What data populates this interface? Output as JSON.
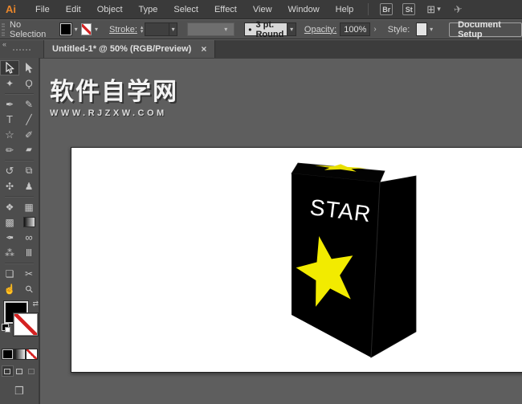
{
  "menu_bar": {
    "logo": "Ai",
    "items": [
      "File",
      "Edit",
      "Object",
      "Type",
      "Select",
      "Effect",
      "View",
      "Window",
      "Help"
    ],
    "bridge_badge": "Br",
    "stock_badge": "St",
    "workspace_icon": "⊞",
    "workspace_chevron": "▾",
    "gpu_icon": "✈"
  },
  "control_bar": {
    "selection_status": "No Selection",
    "fill_chevron": "▾",
    "stroke_chevron": "▾",
    "stroke_label": "Stroke:",
    "spinner_up": "▴",
    "spinner_down": "▾",
    "stroke_weight_value": "",
    "stroke_weight_chevron": "▾",
    "brush_chevron": "▾",
    "profile_dot": "•",
    "profile_value": "3 pt. Round",
    "profile_chevron": "▾",
    "opacity_label": "Opacity:",
    "opacity_value": "100%",
    "opacity_chevron": "›",
    "style_label": "Style:",
    "style_chevron": "▾",
    "document_setup_label": "Document Setup"
  },
  "tab_bar": {
    "collapse_icon": "«",
    "active_tab": "Untitled-1* @ 50% (RGB/Preview)",
    "close_icon": "×"
  },
  "toolbar": {
    "tools": [
      {
        "name": "selection-tool",
        "glyph": ""
      },
      {
        "name": "direct-selection-tool",
        "glyph": ""
      },
      {
        "name": "magic-wand-tool",
        "glyph": "✦"
      },
      {
        "name": "lasso-tool",
        "glyph": "Ϙ"
      },
      {
        "name": "pen-tool",
        "glyph": "✒"
      },
      {
        "name": "curvature-tool",
        "glyph": "✎"
      },
      {
        "name": "type-tool",
        "glyph": "T"
      },
      {
        "name": "line-segment-tool",
        "glyph": "╱"
      },
      {
        "name": "star-shape-tool",
        "glyph": "☆"
      },
      {
        "name": "paintbrush-tool",
        "glyph": "✐"
      },
      {
        "name": "pencil-tool",
        "glyph": "✏"
      },
      {
        "name": "eraser-tool",
        "glyph": "▰"
      },
      {
        "name": "rotate-tool",
        "glyph": "↺"
      },
      {
        "name": "scale-tool",
        "glyph": "⧉"
      },
      {
        "name": "width-tool",
        "glyph": "✣"
      },
      {
        "name": "puppet-warp-tool",
        "glyph": "♟"
      },
      {
        "name": "shape-builder-tool",
        "glyph": "❖"
      },
      {
        "name": "perspective-grid-tool",
        "glyph": "▦"
      },
      {
        "name": "mesh-tool",
        "glyph": "▩"
      },
      {
        "name": "gradient-tool",
        "glyph": ""
      },
      {
        "name": "eyedropper-tool",
        "glyph": "✒"
      },
      {
        "name": "blend-tool",
        "glyph": "∞"
      },
      {
        "name": "symbol-sprayer-tool",
        "glyph": "⁂"
      },
      {
        "name": "column-graph-tool",
        "glyph": "Ⅲ"
      },
      {
        "name": "artboard-tool",
        "glyph": "❏"
      },
      {
        "name": "slice-tool",
        "glyph": "✂"
      },
      {
        "name": "hand-tool",
        "glyph": "☝"
      },
      {
        "name": "zoom-tool",
        "glyph": "⚲"
      }
    ],
    "swap_icon": "⇄",
    "screen_mode_icon": "❒"
  },
  "watermark": {
    "title": "软件自学网",
    "subtitle": "WWW.RJZXW.COM"
  },
  "canvas": {
    "box_text": "STAR",
    "box_color": "#000000",
    "star_color": "#f2eb00"
  },
  "colors": {
    "app_accent_orange": "#e8862b",
    "star_yellow": "#f2eb00",
    "pasteboard_gray": "#5e5e5e",
    "none_slash_red": "#d42222"
  }
}
